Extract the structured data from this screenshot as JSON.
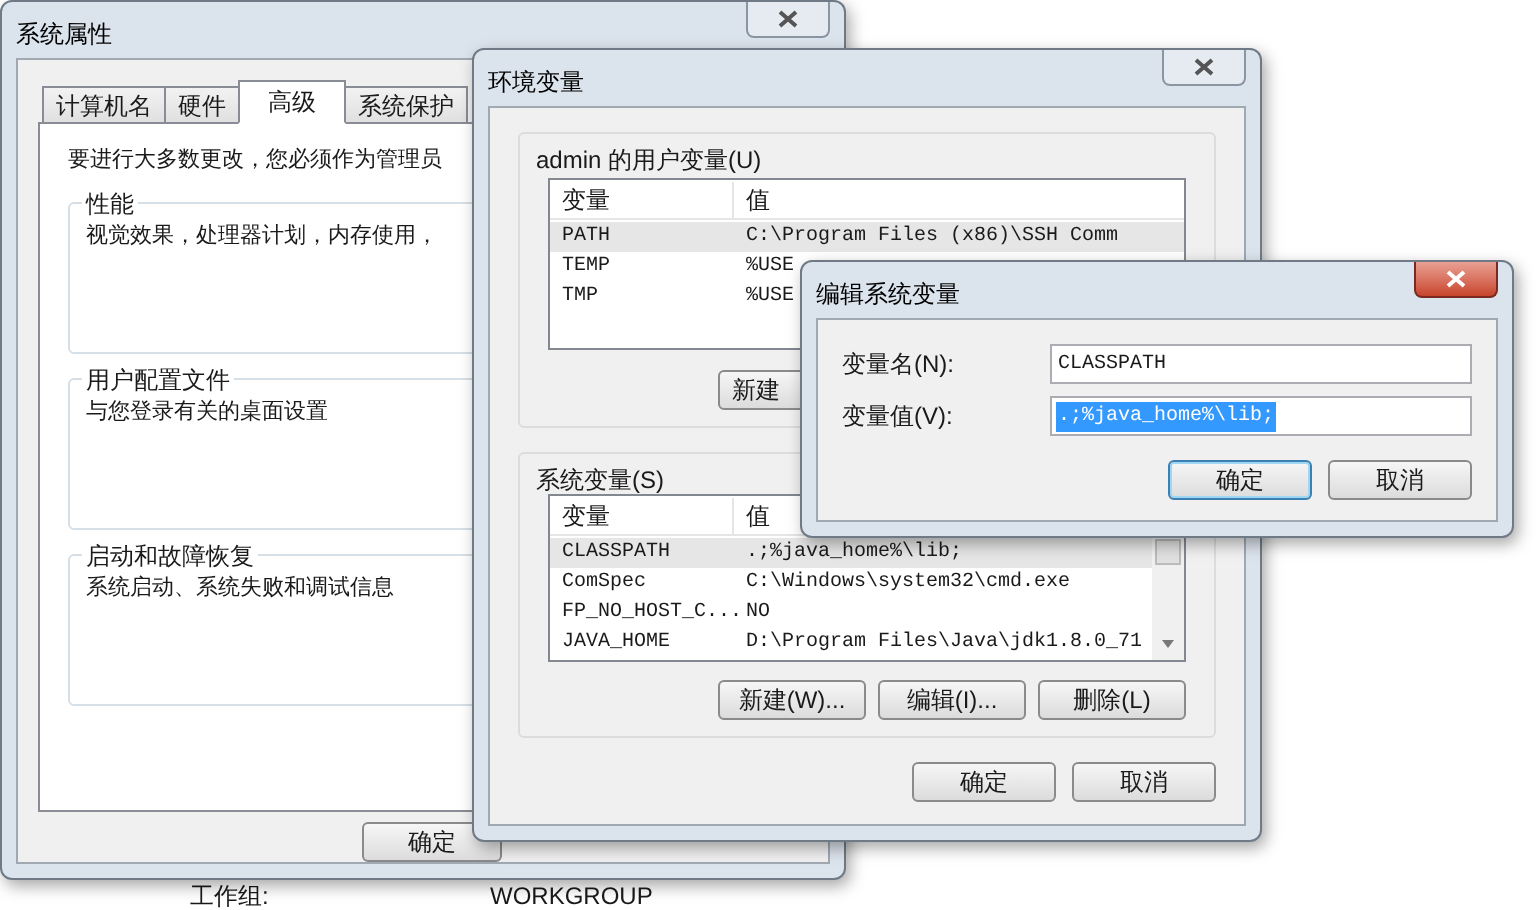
{
  "desktop": {
    "labels": [
      "工作组:",
      "WORKGROUP"
    ]
  },
  "system_properties": {
    "title": "系统属性",
    "tabs": [
      {
        "label": "计算机名",
        "selected": false
      },
      {
        "label": "硬件",
        "selected": false
      },
      {
        "label": "高级",
        "selected": true
      },
      {
        "label": "系统保护",
        "selected": false
      }
    ],
    "notice": "要进行大多数更改，您必须作为管理员",
    "groups": [
      {
        "title": "性能",
        "description": "视觉效果，处理器计划，内存使用，"
      },
      {
        "title": "用户配置文件",
        "description": "与您登录有关的桌面设置"
      },
      {
        "title": "启动和故障恢复",
        "description": "系统启动、系统失败和调试信息"
      }
    ],
    "buttons": [
      "确定"
    ]
  },
  "environment_variables": {
    "title": "环境变量",
    "user_variables": {
      "title": "admin 的用户变量(U)",
      "columns": [
        "变量",
        "值"
      ],
      "rows": [
        {
          "name": "PATH",
          "value": "C:\\Program Files (x86)\\SSH Comm",
          "selected": true
        },
        {
          "name": "TEMP",
          "value": "%USE",
          "selected": false
        },
        {
          "name": "TMP",
          "value": "%USE",
          "selected": false
        }
      ],
      "buttons": [
        "新建"
      ]
    },
    "system_variables": {
      "title": "系统变量(S)",
      "columns": [
        "变量",
        "值"
      ],
      "rows": [
        {
          "name": "CLASSPATH",
          "value": ".;%java_home%\\lib;",
          "selected": true
        },
        {
          "name": "ComSpec",
          "value": "C:\\Windows\\system32\\cmd.exe",
          "selected": false
        },
        {
          "name": "FP_NO_HOST_C...",
          "value": "NO",
          "selected": false
        },
        {
          "name": "JAVA_HOME",
          "value": "D:\\Program Files\\Java\\jdk1.8.0_71",
          "selected": false
        }
      ],
      "buttons": [
        "新建(W)...",
        "编辑(I)...",
        "删除(L)"
      ]
    },
    "buttons": [
      "确定",
      "取消"
    ]
  },
  "edit_dialog": {
    "title": "编辑系统变量",
    "fields": [
      {
        "label": "变量名(N):",
        "value": "CLASSPATH",
        "selected": false
      },
      {
        "label": "变量值(V):",
        "value": ".;%java_home%\\lib;",
        "selected": true
      }
    ],
    "buttons": [
      {
        "label": "确定",
        "focused": true
      },
      {
        "label": "取消",
        "focused": false
      }
    ]
  }
}
